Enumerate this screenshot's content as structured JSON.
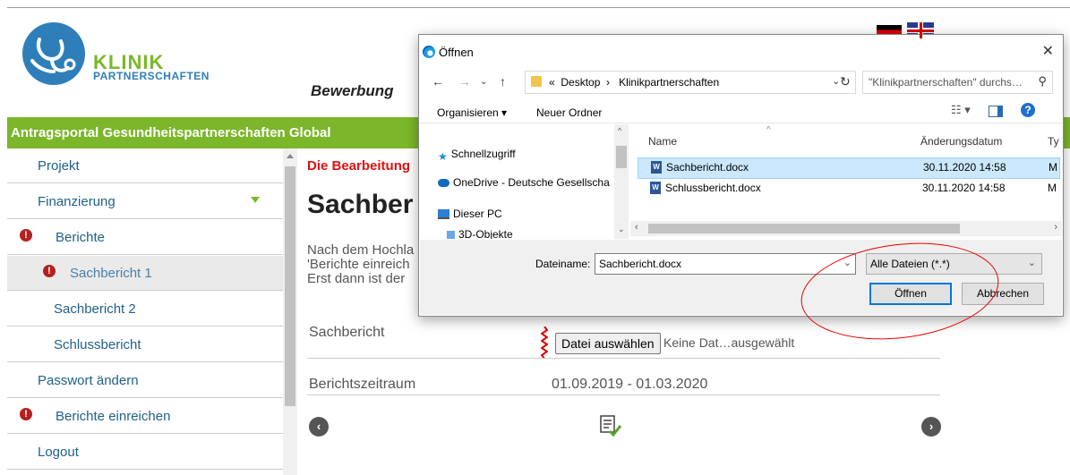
{
  "header": {
    "logo_line1": "KLINIK",
    "logo_line2": "PARTNERSCHAFTEN",
    "bewerbung": "Bewerbung",
    "portal_title": "Antragsportal Gesundheitspartnerschaften Global"
  },
  "sidebar": {
    "items": [
      {
        "label": "Projekt"
      },
      {
        "label": "Finanzierung"
      },
      {
        "label": "Berichte"
      },
      {
        "label": "Sachbericht 1"
      },
      {
        "label": "Sachbericht 2"
      },
      {
        "label": "Schlussbericht"
      },
      {
        "label": "Passwort ändern"
      },
      {
        "label": "Berichte einreichen"
      },
      {
        "label": "Logout"
      }
    ]
  },
  "main": {
    "notice": "Die Bearbeitung",
    "heading": "Sachber",
    "para_lines": [
      "Nach dem Hochla",
      "'Berichte einreich",
      "Erst dann ist der"
    ],
    "sachbericht_label": "Sachbericht",
    "file_button": "Datei auswählen",
    "file_none": "Keine Dat…ausgewählt",
    "period_label": "Berichtszeitraum",
    "period_value": "01.09.2019 - 01.03.2020"
  },
  "dialog": {
    "title": "Öffnen",
    "close": "✕",
    "address": {
      "prefix": "«",
      "segments": [
        "Desktop",
        "Klinikpartnerschaften"
      ],
      "search_placeholder": "\"Klinikpartnerschaften\" durchs…"
    },
    "toolbar": {
      "organize": "Organisieren ▾",
      "new_folder": "Neuer Ordner"
    },
    "tree": [
      {
        "label": "Schnellzugriff",
        "icon": "star-icon"
      },
      {
        "label": "OneDrive - Deutsche Gesellscha",
        "icon": "cloud-icon"
      },
      {
        "label": "Dieser PC",
        "icon": "pc-icon"
      },
      {
        "label": "3D-Objekte",
        "icon": "cube-icon"
      }
    ],
    "columns": {
      "name": "Name",
      "date": "Änderungsdatum",
      "type": "Ty"
    },
    "files": [
      {
        "name": "Sachbericht.docx",
        "date": "30.11.2020 14:58",
        "type": "M",
        "selected": true
      },
      {
        "name": "Schlussbericht.docx",
        "date": "30.11.2020 14:58",
        "type": "M",
        "selected": false
      }
    ],
    "filename_label": "Dateiname:",
    "filename_value": "Sachbericht.docx",
    "filetype_value": "Alle Dateien (*.*)",
    "open_button": "Öffnen",
    "cancel_button": "Abbrechen"
  },
  "colors": {
    "green": "#7cb62a",
    "nav_text": "#1f5f8b",
    "notice_red": "#e01010",
    "highlight": "#cce8ff"
  }
}
